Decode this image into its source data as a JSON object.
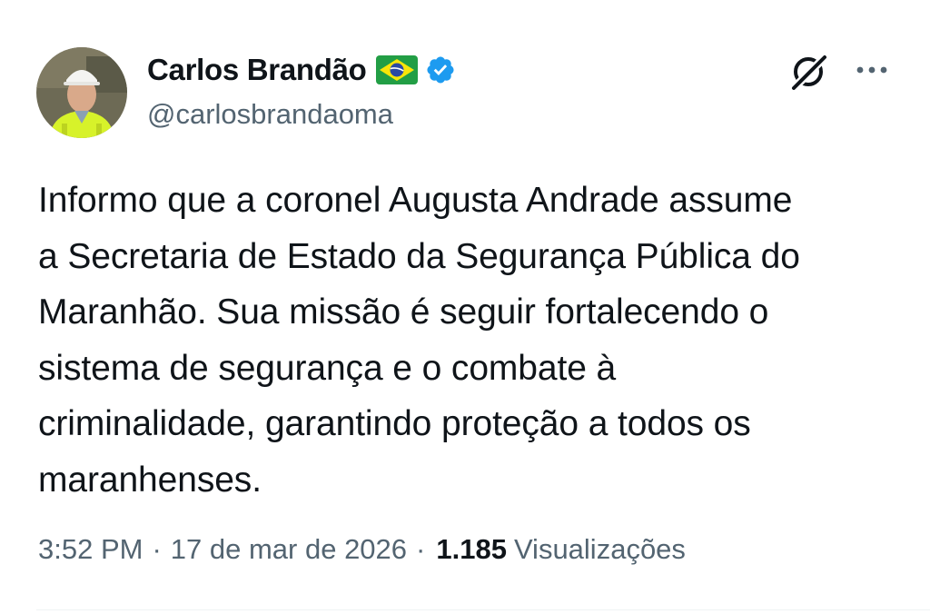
{
  "tweet": {
    "author": {
      "display_name": "Carlos Brandão",
      "handle": "@carlosbrandaoma",
      "flag_icon": "brazil-flag-icon",
      "verified_icon": "verified-badge-icon",
      "verified_color": "#1d9bf0"
    },
    "text": "Informo que a coronel Augusta Andrade assume\na Secretaria de Estado da Segurança Pública do\nMaranhão. Sua missão é seguir fortalecendo o\nsistema de segurança e o combate à\ncriminalidade, garantindo proteção a todos os\nmaranhenses.",
    "meta": {
      "time": "3:52 PM",
      "separator": "·",
      "date": "17 de mar de 2026",
      "separator2": "·",
      "views_count": "1.185",
      "views_label": "Visualizações"
    },
    "actions": {
      "grok_icon": "grok-icon",
      "more_icon": "more-options-icon"
    }
  },
  "colors": {
    "text_primary": "#0f1419",
    "text_secondary": "#536471",
    "accent": "#1d9bf0"
  }
}
